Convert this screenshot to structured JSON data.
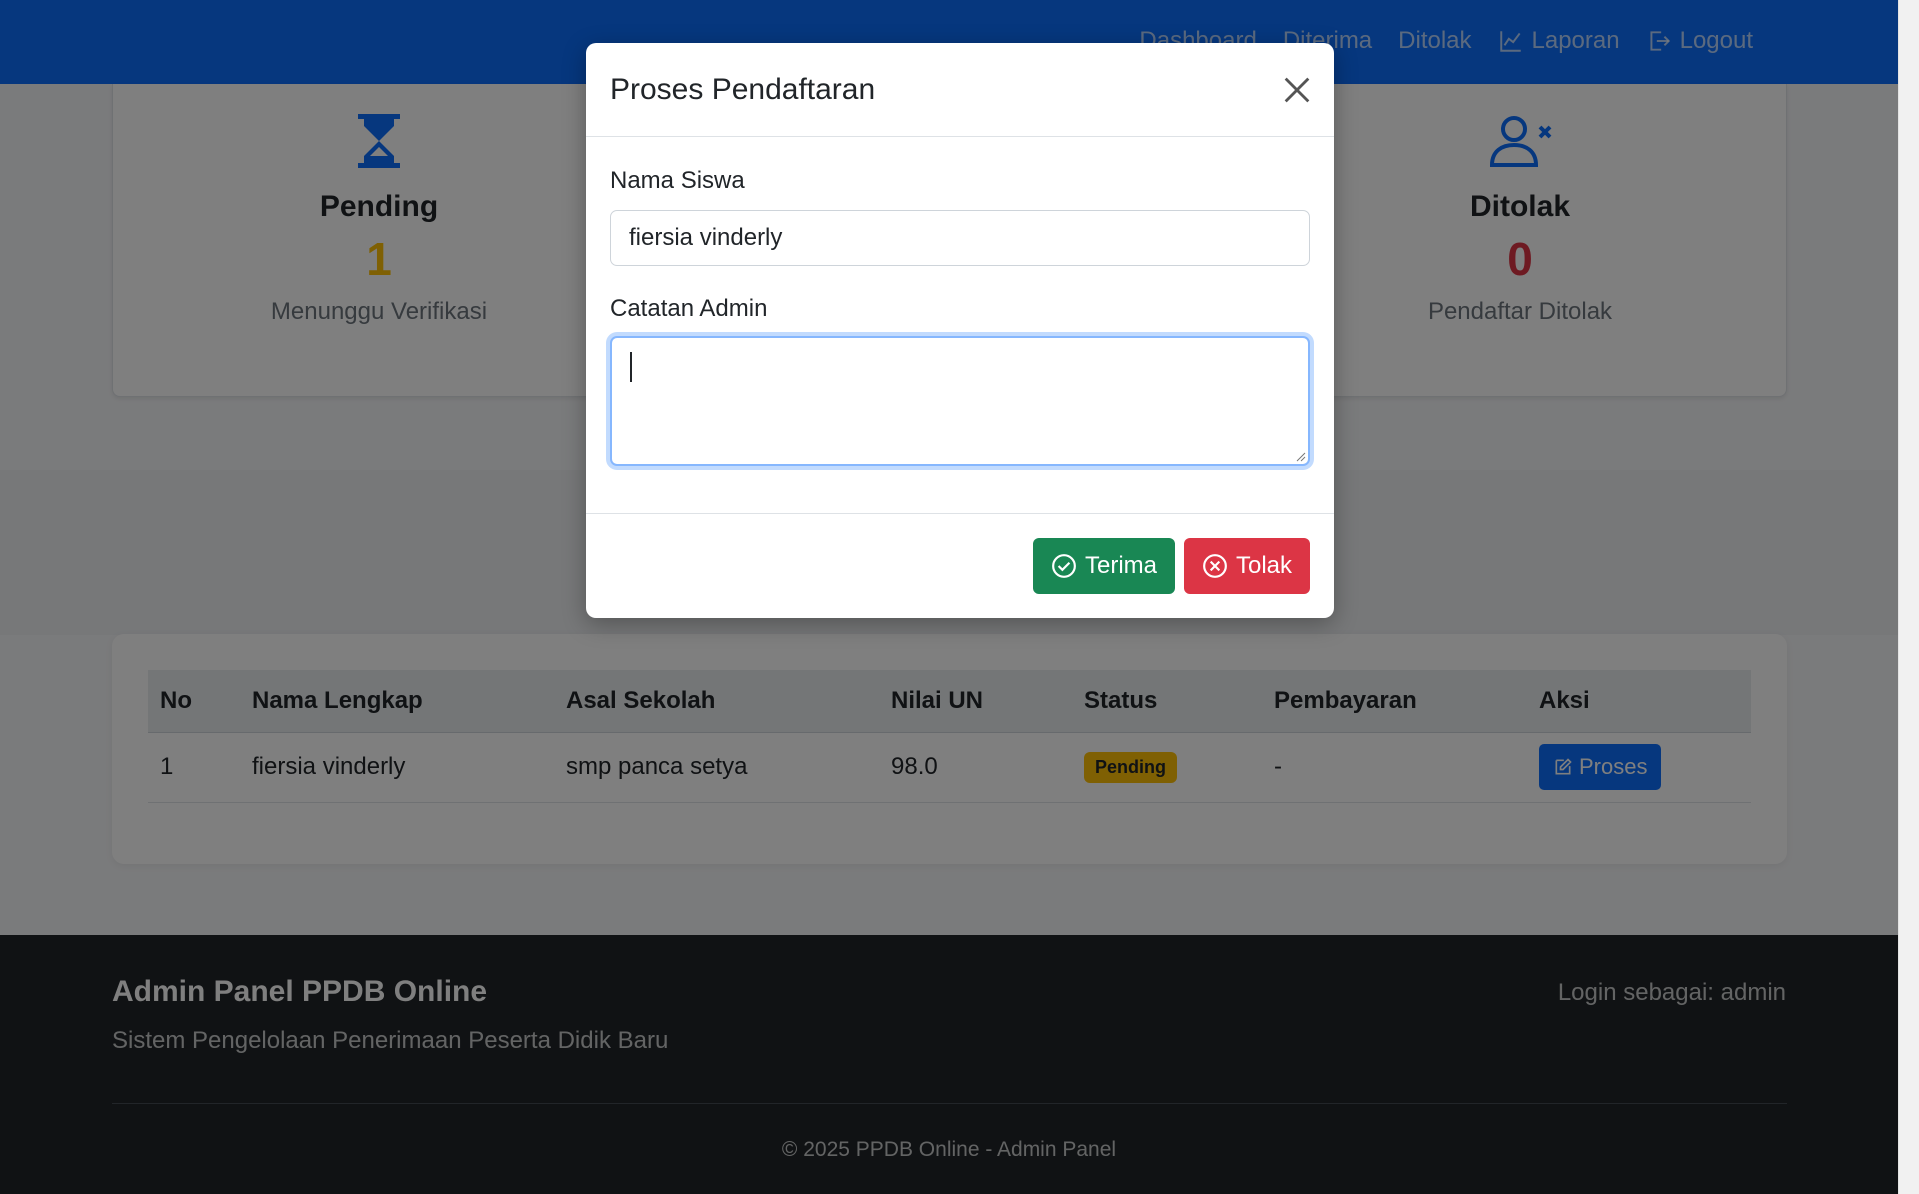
{
  "nav": {
    "links": [
      {
        "label": "Dashboard"
      },
      {
        "label": "Diterima"
      },
      {
        "label": "Ditolak"
      },
      {
        "label": "Laporan"
      },
      {
        "label": "Logout"
      }
    ]
  },
  "stats": {
    "pending": {
      "label": "Pending",
      "value": "1",
      "sub": "Menunggu Verifikasi",
      "color": "#ffc107"
    },
    "ditolak": {
      "label": "Ditolak",
      "value": "0",
      "sub": "Pendaftar Ditolak",
      "color": "#dc3545"
    }
  },
  "table": {
    "headers": [
      "No",
      "Nama Lengkap",
      "Asal Sekolah",
      "Nilai UN",
      "Status",
      "Pembayaran",
      "Aksi"
    ],
    "rows": [
      {
        "no": "1",
        "nama": "fiersia vinderly",
        "sekolah": "smp panca setya",
        "nilai": "98.0",
        "status": "Pending",
        "pembayaran": "-",
        "aksi": "Proses"
      }
    ]
  },
  "footer": {
    "title": "Admin Panel PPDB Online",
    "subtitle": "Sistem Pengelolaan Penerimaan Peserta Didik Baru",
    "login": "Login sebagai: admin",
    "copyright": "© 2025 PPDB Online - Admin Panel"
  },
  "modal": {
    "title": "Proses Pendaftaran",
    "nama_label": "Nama Siswa",
    "nama_value": "fiersia vinderly",
    "catatan_label": "Catatan Admin",
    "catatan_value": "",
    "terima_label": "Terima",
    "tolak_label": "Tolak"
  },
  "colors": {
    "primary": "#0d6efd",
    "success": "#198754",
    "danger": "#dc3545",
    "warning": "#ffc107"
  }
}
